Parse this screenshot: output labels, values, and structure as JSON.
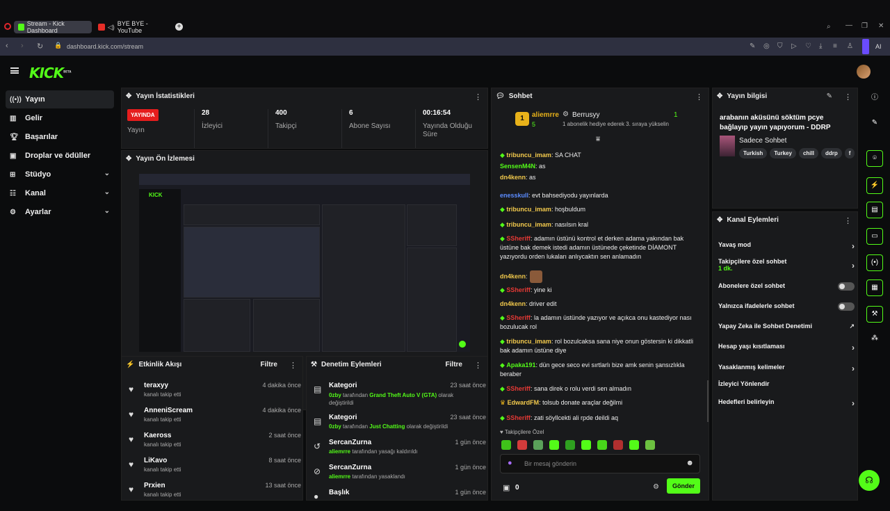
{
  "browser": {
    "tabs": [
      {
        "label": "Stream - Kick Dashboard"
      },
      {
        "label": "BYE BYE - YouTube"
      }
    ],
    "url": "dashboard.kick.com/stream",
    "ai_label": "AI"
  },
  "brand": {
    "logo": "KICK",
    "beta": "BETA",
    "accent": "#53fc18"
  },
  "sidebar": {
    "items": [
      {
        "label": "Yayın",
        "icon": "broadcast-icon"
      },
      {
        "label": "Gelir",
        "icon": "chart-icon"
      },
      {
        "label": "Başarılar",
        "icon": "trophy-icon"
      },
      {
        "label": "Droplar ve ödüller",
        "icon": "gift-icon"
      },
      {
        "label": "Stüdyo",
        "icon": "studio-icon"
      },
      {
        "label": "Kanal",
        "icon": "channel-icon"
      },
      {
        "label": "Ayarlar",
        "icon": "gear-icon"
      }
    ]
  },
  "stats": {
    "title": "Yayın İstatistikleri",
    "live_badge": "YAYINDA",
    "live_label": "Yayın",
    "viewers_value": "28",
    "viewers_label": "İzleyici",
    "followers_value": "400",
    "followers_label": "Takipçi",
    "subs_value": "6",
    "subs_label": "Abone Sayısı",
    "duration_value": "00:16:54",
    "duration_label": "Yayında Olduğu Süre"
  },
  "preview": {
    "title": "Yayın Ön İzlemesi"
  },
  "activity": {
    "title": "Etkinlik Akışı",
    "filter": "Filtre",
    "rows": [
      {
        "name": "teraxyy",
        "sub": "kanalı takip etti",
        "time": "4 dakika önce"
      },
      {
        "name": "AnneniScream",
        "sub": "kanalı takip etti",
        "time": "4 dakika önce"
      },
      {
        "name": "Kaeross",
        "sub": "kanalı takip etti",
        "time": "2 saat önce"
      },
      {
        "name": "LiKavo",
        "sub": "kanalı takip etti",
        "time": "8 saat önce"
      },
      {
        "name": "Prxien",
        "sub": "kanalı takip etti",
        "time": "13 saat önce"
      }
    ]
  },
  "moderation": {
    "title": "Denetim Eylemleri",
    "filter": "Filtre",
    "rows": [
      {
        "name": "Kategori",
        "user": "0zby",
        "mid": " tarafından ",
        "hl": "Grand Theft Auto V (GTA)",
        "end": " olarak değiştirildi",
        "time": "23 saat önce"
      },
      {
        "name": "Kategori",
        "user": "0zby",
        "mid": " tarafından ",
        "hl": "Just Chatting",
        "end": " olarak değiştirildi",
        "time": "23 saat önce"
      },
      {
        "name": "SercanZurna",
        "user": "aliemrre",
        "mid": " tarafından yasağı kaldırıldı",
        "hl": "",
        "end": "",
        "time": "1 gün önce"
      },
      {
        "name": "SercanZurna",
        "user": "aliemrre",
        "mid": " tarafından yasaklandı",
        "hl": "",
        "end": "",
        "time": "1 gün önce"
      },
      {
        "name": "Başlık",
        "user": "",
        "mid": "",
        "hl": "",
        "end": "",
        "time": "1 gün önce"
      }
    ]
  },
  "chat": {
    "title": "Sohbet",
    "pinned_user": "aliemrre",
    "pinned_count": "5",
    "pinned_gifter": "Berrusyy",
    "pinned_text": "1 abonelik hediye ederek 3. sıraya yükselin",
    "pinned_rank": "1",
    "pinned_right": "1",
    "messages": [
      {
        "user": "tribuncu_imam",
        "color": "#f2c94c",
        "gem": true,
        "text": ": SA CHAT"
      },
      {
        "user": "SensenM4N",
        "color": "#53fc18",
        "gem": false,
        "text": ": as"
      },
      {
        "user": "dn4kenn",
        "color": "#f2c94c",
        "gem": false,
        "text": ": as"
      },
      {
        "user": "enesskull",
        "color": "#5b8cff",
        "gem": false,
        "text": ": evt bahsediyodu yayınlarda"
      },
      {
        "user": "tribuncu_imam",
        "color": "#f2c94c",
        "gem": true,
        "text": ": hoşbuldum"
      },
      {
        "user": "tribuncu_imam",
        "color": "#f2c94c",
        "gem": true,
        "text": ": nasılsın kral"
      },
      {
        "user": "SSheriff",
        "color": "#e53935",
        "gem": true,
        "text": ": adamın üstünü kontrol et derken adama yakından bak üstüne bak demek istedi adamın üstünede çeketinde DİAMONT yazıyordu orden lukaları anlıycaktın sen anlamadın"
      },
      {
        "user": "dn4kenn",
        "color": "#f2c94c",
        "gem": false,
        "text": ":"
      },
      {
        "user": "SSheriff",
        "color": "#e53935",
        "gem": true,
        "text": ": yine ki"
      },
      {
        "user": "dn4kenn",
        "color": "#f2c94c",
        "gem": false,
        "text": ": driver edit"
      },
      {
        "user": "SSheriff",
        "color": "#e53935",
        "gem": true,
        "text": ": la adamın üstünde yazıyor ve açıkca onu kastediyor nası bozulucak rol"
      },
      {
        "user": "tribuncu_imam",
        "color": "#f2c94c",
        "gem": true,
        "text": ": rol bozulcaksa sana niye onun göstersin ki dikkatli bak adamın üstüne diye"
      },
      {
        "user": "Apaka191",
        "color": "#53fc18",
        "gem": true,
        "text": ": dün gece seco evi sırtlarlı bize amk senin şansızlıkla beraber"
      },
      {
        "user": "SSheriff",
        "color": "#e53935",
        "gem": true,
        "text": ": sana direk o rolu verdi sen almadın"
      },
      {
        "user": "EdwardFM",
        "color": "#f2c94c",
        "gem": false,
        "crown": true,
        "text": ": tolsub donate araçlar değilmi"
      },
      {
        "user": "SSheriff",
        "color": "#e53935",
        "gem": true,
        "text": ": zati söyllcekti ali rpde deildi aq"
      }
    ],
    "emote_label": "Takipçilere Özel",
    "input_placeholder": "Bir mesaj gönderin",
    "points": "0",
    "send_label": "Gönder"
  },
  "stream_info": {
    "title": "Yayın bilgisi",
    "stream_title": "arabanın aküsünü söktüm pcye bağlayıp yayın yapıyorum - DDRP",
    "category": "Sadece Sohbet",
    "tags": [
      "Turkish",
      "Turkey",
      "chill",
      "ddrp",
      "f"
    ]
  },
  "channel_actions": {
    "title": "Kanal Eylemleri",
    "rows": [
      {
        "label": "Yavaş mod",
        "kind": "chevron"
      },
      {
        "label": "Takipçilere özel sohbet",
        "sub": "1 dk.",
        "kind": "chevron"
      },
      {
        "label": "Abonelere özel sohbet",
        "kind": "toggle"
      },
      {
        "label": "Yalnızca ifadelerle sohbet",
        "kind": "toggle"
      },
      {
        "label": "Yapay Zeka ile Sohbet Denetimi",
        "kind": "external"
      },
      {
        "label": "Hesap yaşı kısıtlaması",
        "kind": "chevron"
      },
      {
        "label": "Yasaklanmış kelimeler",
        "kind": "chevron"
      },
      {
        "label": "İzleyici Yönlendir",
        "kind": "none"
      },
      {
        "label": "Hedefleri belirleyin",
        "kind": "chevron"
      }
    ]
  }
}
